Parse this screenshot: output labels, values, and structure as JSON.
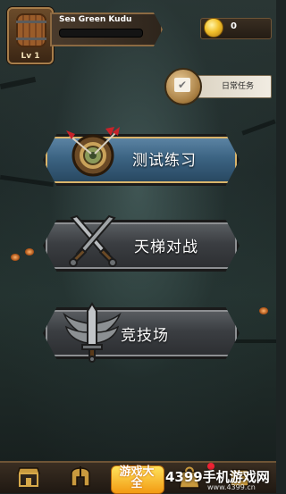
{
  "player": {
    "name": "Sea Green  Kudu",
    "level": "Lv 1",
    "coins": "0"
  },
  "daily_task": {
    "label": "日常任务"
  },
  "menu": [
    {
      "label": "测试练习",
      "icon": "target-arrows-icon",
      "active": true
    },
    {
      "label": "天梯对战",
      "icon": "crossed-swords-icon",
      "active": false
    },
    {
      "label": "竞技场",
      "icon": "winged-sword-icon",
      "active": false
    }
  ],
  "bottom_nav": [
    {
      "icon": "shop-icon"
    },
    {
      "icon": "helmet-icon"
    },
    {
      "icon": "bag-icon"
    },
    {
      "icon": "notification-icon"
    }
  ],
  "overlay": {
    "promo_text": "游戏大全",
    "watermark": "4399手机游戏网",
    "watermark_url": "www.4399.cn"
  },
  "colors": {
    "active_button": "#3c6483",
    "inactive_button": "#3b3e42",
    "gold": "#f2c12c",
    "notification": "#e23333"
  }
}
